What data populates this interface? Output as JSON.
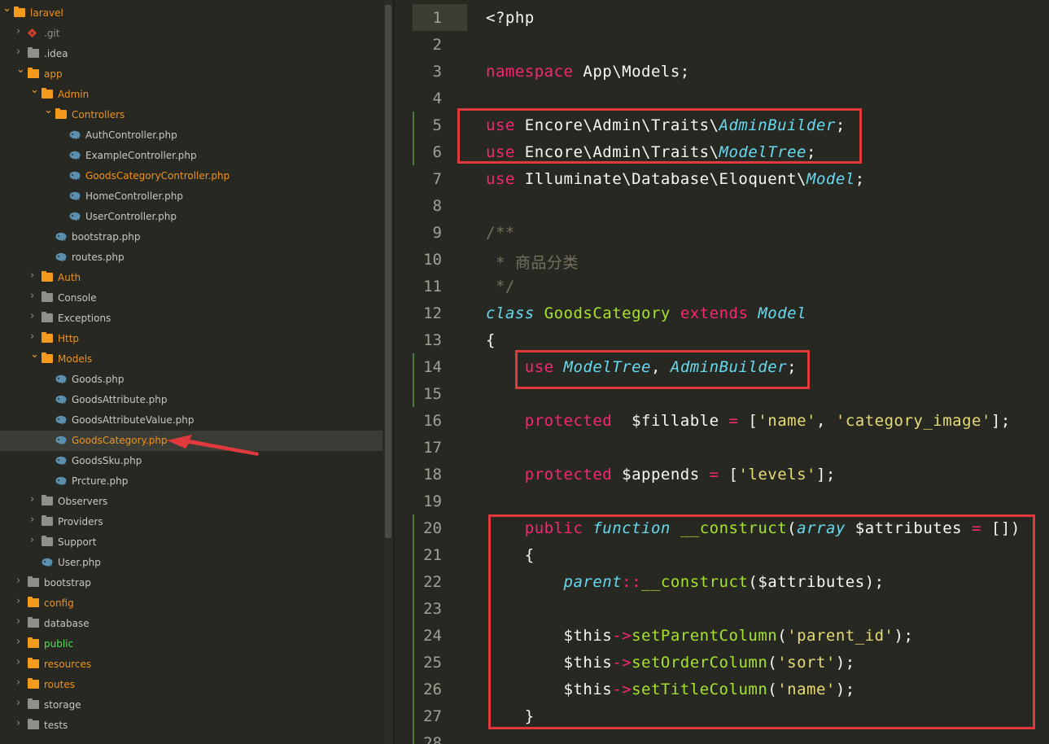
{
  "colors": {
    "accent_orange": "#f49a1d",
    "annotation_red": "#e0393e",
    "keyword": "#f92672",
    "type": "#66d9ef",
    "string": "#e6db74",
    "function": "#a6e22e",
    "comment": "#75715e",
    "background": "#272822"
  },
  "sidebar": {
    "items": [
      {
        "label": "laravel",
        "depth": 0,
        "type": "folder",
        "open": true,
        "color": "orange"
      },
      {
        "label": ".git",
        "depth": 1,
        "type": "git",
        "open": false,
        "color": "gray"
      },
      {
        "label": ".idea",
        "depth": 1,
        "type": "folder",
        "open": false,
        "color": "normal"
      },
      {
        "label": "app",
        "depth": 1,
        "type": "folder",
        "open": true,
        "color": "orange"
      },
      {
        "label": "Admin",
        "depth": 2,
        "type": "folder",
        "open": true,
        "color": "orange"
      },
      {
        "label": "Controllers",
        "depth": 3,
        "type": "folder",
        "open": true,
        "color": "orange"
      },
      {
        "label": "AuthController.php",
        "depth": 4,
        "type": "php",
        "color": "normal"
      },
      {
        "label": "ExampleController.php",
        "depth": 4,
        "type": "php",
        "color": "normal"
      },
      {
        "label": "GoodsCategoryController.php",
        "depth": 4,
        "type": "php",
        "color": "orange"
      },
      {
        "label": "HomeController.php",
        "depth": 4,
        "type": "php",
        "color": "normal"
      },
      {
        "label": "UserController.php",
        "depth": 4,
        "type": "php",
        "color": "normal"
      },
      {
        "label": "bootstrap.php",
        "depth": 3,
        "type": "php",
        "color": "normal"
      },
      {
        "label": "routes.php",
        "depth": 3,
        "type": "php",
        "color": "normal"
      },
      {
        "label": "Auth",
        "depth": 2,
        "type": "folder",
        "open": false,
        "color": "orange"
      },
      {
        "label": "Console",
        "depth": 2,
        "type": "folder",
        "open": false,
        "color": "normal"
      },
      {
        "label": "Exceptions",
        "depth": 2,
        "type": "folder",
        "open": false,
        "color": "normal"
      },
      {
        "label": "Http",
        "depth": 2,
        "type": "folder",
        "open": false,
        "color": "orange"
      },
      {
        "label": "Models",
        "depth": 2,
        "type": "folder",
        "open": true,
        "color": "orange"
      },
      {
        "label": "Goods.php",
        "depth": 3,
        "type": "php",
        "color": "normal"
      },
      {
        "label": "GoodsAttribute.php",
        "depth": 3,
        "type": "php",
        "color": "normal"
      },
      {
        "label": "GoodsAttributeValue.php",
        "depth": 3,
        "type": "php",
        "color": "normal"
      },
      {
        "label": "GoodsCategory.php",
        "depth": 3,
        "type": "php",
        "color": "orange",
        "selected": true
      },
      {
        "label": "GoodsSku.php",
        "depth": 3,
        "type": "php",
        "color": "normal"
      },
      {
        "label": "Prcture.php",
        "depth": 3,
        "type": "php",
        "color": "normal"
      },
      {
        "label": "Observers",
        "depth": 2,
        "type": "folder",
        "open": false,
        "color": "normal"
      },
      {
        "label": "Providers",
        "depth": 2,
        "type": "folder",
        "open": false,
        "color": "normal"
      },
      {
        "label": "Support",
        "depth": 2,
        "type": "folder",
        "open": false,
        "color": "normal"
      },
      {
        "label": "User.php",
        "depth": 2,
        "type": "php",
        "color": "normal"
      },
      {
        "label": "bootstrap",
        "depth": 1,
        "type": "folder",
        "open": false,
        "color": "normal"
      },
      {
        "label": "config",
        "depth": 1,
        "type": "folder",
        "open": false,
        "color": "orange"
      },
      {
        "label": "database",
        "depth": 1,
        "type": "folder",
        "open": false,
        "color": "normal"
      },
      {
        "label": "public",
        "depth": 1,
        "type": "folder",
        "open": false,
        "color": "green"
      },
      {
        "label": "resources",
        "depth": 1,
        "type": "folder",
        "open": false,
        "color": "orange"
      },
      {
        "label": "routes",
        "depth": 1,
        "type": "folder",
        "open": false,
        "color": "orange"
      },
      {
        "label": "storage",
        "depth": 1,
        "type": "folder",
        "open": false,
        "color": "normal"
      },
      {
        "label": "tests",
        "depth": 1,
        "type": "folder",
        "open": false,
        "color": "normal"
      }
    ]
  },
  "editor": {
    "lines": [
      [
        [
          "pl",
          "<?php"
        ]
      ],
      [],
      [
        [
          "kw",
          "namespace"
        ],
        [
          "pl",
          " App\\Models;"
        ]
      ],
      [],
      [
        [
          "kw",
          "use"
        ],
        [
          "pl",
          " Encore\\Admin\\Traits\\"
        ],
        [
          "st",
          "AdminBuilder"
        ],
        [
          "pl",
          ";"
        ]
      ],
      [
        [
          "kw",
          "use"
        ],
        [
          "pl",
          " Encore\\Admin\\Traits\\"
        ],
        [
          "st",
          "ModelTree"
        ],
        [
          "pl",
          ";"
        ]
      ],
      [
        [
          "kw",
          "use"
        ],
        [
          "pl",
          " Illuminate\\Database\\Eloquent\\"
        ],
        [
          "st",
          "Model"
        ],
        [
          "pl",
          ";"
        ]
      ],
      [],
      [
        [
          "cm",
          "/**"
        ]
      ],
      [
        [
          "cm",
          " * 商品分类"
        ]
      ],
      [
        [
          "cm",
          " */"
        ]
      ],
      [
        [
          "st",
          "class"
        ],
        [
          "pl",
          " "
        ],
        [
          "cls",
          "GoodsCategory"
        ],
        [
          "pl",
          " "
        ],
        [
          "kw",
          "extends"
        ],
        [
          "pl",
          " "
        ],
        [
          "st",
          "Model"
        ]
      ],
      [
        [
          "pl",
          "{"
        ]
      ],
      [
        [
          "pl",
          "    "
        ],
        [
          "kw",
          "use"
        ],
        [
          "pl",
          " "
        ],
        [
          "st",
          "ModelTree"
        ],
        [
          "pl",
          ", "
        ],
        [
          "st",
          "AdminBuilder"
        ],
        [
          "pl",
          ";"
        ]
      ],
      [],
      [
        [
          "pl",
          "    "
        ],
        [
          "kw",
          "protected"
        ],
        [
          "pl",
          "  $fillable "
        ],
        [
          "op",
          "="
        ],
        [
          "pl",
          " ["
        ],
        [
          "str",
          "'name'"
        ],
        [
          "pl",
          ", "
        ],
        [
          "str",
          "'category_image'"
        ],
        [
          "pl",
          "];"
        ]
      ],
      [],
      [
        [
          "pl",
          "    "
        ],
        [
          "kw",
          "protected"
        ],
        [
          "pl",
          " $appends "
        ],
        [
          "op",
          "="
        ],
        [
          "pl",
          " ["
        ],
        [
          "str",
          "'levels'"
        ],
        [
          "pl",
          "];"
        ]
      ],
      [],
      [
        [
          "pl",
          "    "
        ],
        [
          "kw",
          "public"
        ],
        [
          "pl",
          " "
        ],
        [
          "st",
          "function"
        ],
        [
          "pl",
          " "
        ],
        [
          "fn",
          "__construct"
        ],
        [
          "pl",
          "("
        ],
        [
          "st",
          "array"
        ],
        [
          "pl",
          " $attributes "
        ],
        [
          "op",
          "="
        ],
        [
          "pl",
          " [])"
        ]
      ],
      [
        [
          "pl",
          "    {"
        ]
      ],
      [
        [
          "pl",
          "        "
        ],
        [
          "st",
          "parent"
        ],
        [
          "op",
          "::"
        ],
        [
          "fn",
          "__construct"
        ],
        [
          "pl",
          "($attributes);"
        ]
      ],
      [],
      [
        [
          "pl",
          "        $this"
        ],
        [
          "op",
          "->"
        ],
        [
          "fn",
          "setParentColumn"
        ],
        [
          "pl",
          "("
        ],
        [
          "str",
          "'parent_id'"
        ],
        [
          "pl",
          ");"
        ]
      ],
      [
        [
          "pl",
          "        $this"
        ],
        [
          "op",
          "->"
        ],
        [
          "fn",
          "setOrderColumn"
        ],
        [
          "pl",
          "("
        ],
        [
          "str",
          "'sort'"
        ],
        [
          "pl",
          ");"
        ]
      ],
      [
        [
          "pl",
          "        $this"
        ],
        [
          "op",
          "->"
        ],
        [
          "fn",
          "setTitleColumn"
        ],
        [
          "pl",
          "("
        ],
        [
          "str",
          "'name'"
        ],
        [
          "pl",
          ");"
        ]
      ],
      [
        [
          "pl",
          "    }"
        ]
      ],
      []
    ]
  }
}
